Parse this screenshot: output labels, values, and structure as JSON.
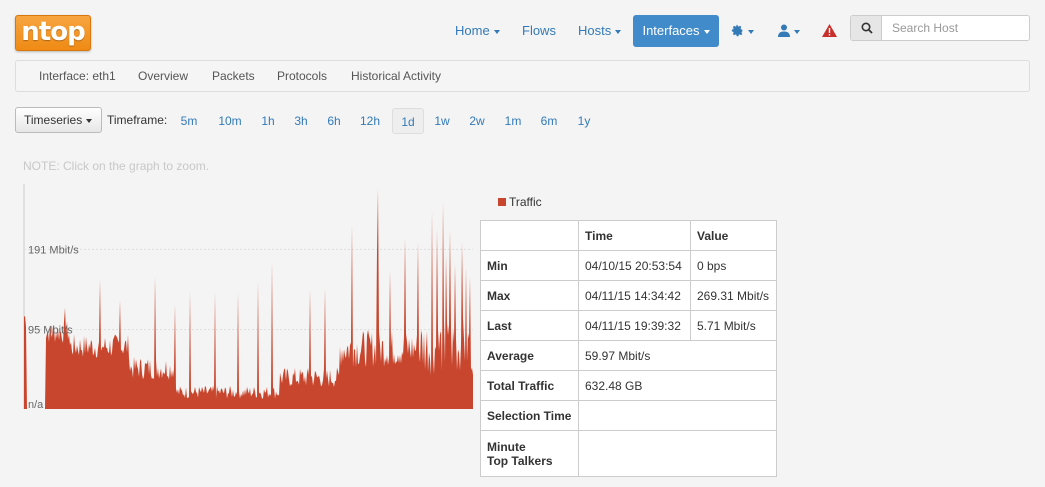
{
  "brand": {
    "logo_text": "ntop"
  },
  "nav": {
    "home": "Home",
    "flows": "Flows",
    "hosts": "Hosts",
    "interfaces": "Interfaces",
    "settings_icon": "gear-icon",
    "user_icon": "user-icon",
    "alert_icon": "warning-icon"
  },
  "search": {
    "placeholder": "Search Host",
    "icon": "search-icon"
  },
  "subnav": {
    "interface": "Interface: eth1",
    "overview": "Overview",
    "packets": "Packets",
    "protocols": "Protocols",
    "historical": "Historical Activity"
  },
  "timeframe": {
    "dropdown": "Timeseries",
    "label": "Timeframe:",
    "options": [
      "5m",
      "10m",
      "1h",
      "3h",
      "6h",
      "12h",
      "1d",
      "1w",
      "2w",
      "1m",
      "6m",
      "1y"
    ],
    "selected": "1d"
  },
  "note": "NOTE: Click on the graph to zoom.",
  "chart_data": {
    "type": "area",
    "y_tick_labels": [
      "191 Mbit/s",
      "95 Mbit/s",
      "n/a"
    ],
    "y_ticks": [
      191,
      95,
      0
    ],
    "ylim": [
      0,
      269.31
    ],
    "series": [
      {
        "name": "Traffic",
        "color": "#c8462d"
      }
    ],
    "grid": "horizontal dotted"
  },
  "legend": {
    "label": "Traffic",
    "color": "#c8462d"
  },
  "stats": {
    "headers": [
      "",
      "Time",
      "Value"
    ],
    "min": {
      "label": "Min",
      "time": "04/10/15 20:53:54",
      "value": "0 bps"
    },
    "max": {
      "label": "Max",
      "time": "04/11/15 14:34:42",
      "value": "269.31 Mbit/s"
    },
    "last": {
      "label": "Last",
      "time": "04/11/15 19:39:32",
      "value": "5.71 Mbit/s"
    },
    "average": {
      "label": "Average",
      "value": "59.97 Mbit/s"
    },
    "total": {
      "label": "Total Traffic",
      "value": "632.48 GB"
    },
    "selection": {
      "label": "Selection Time",
      "value": ""
    },
    "talkers": {
      "label_line1": "Minute",
      "label_line2": "Top Talkers",
      "value": ""
    }
  }
}
